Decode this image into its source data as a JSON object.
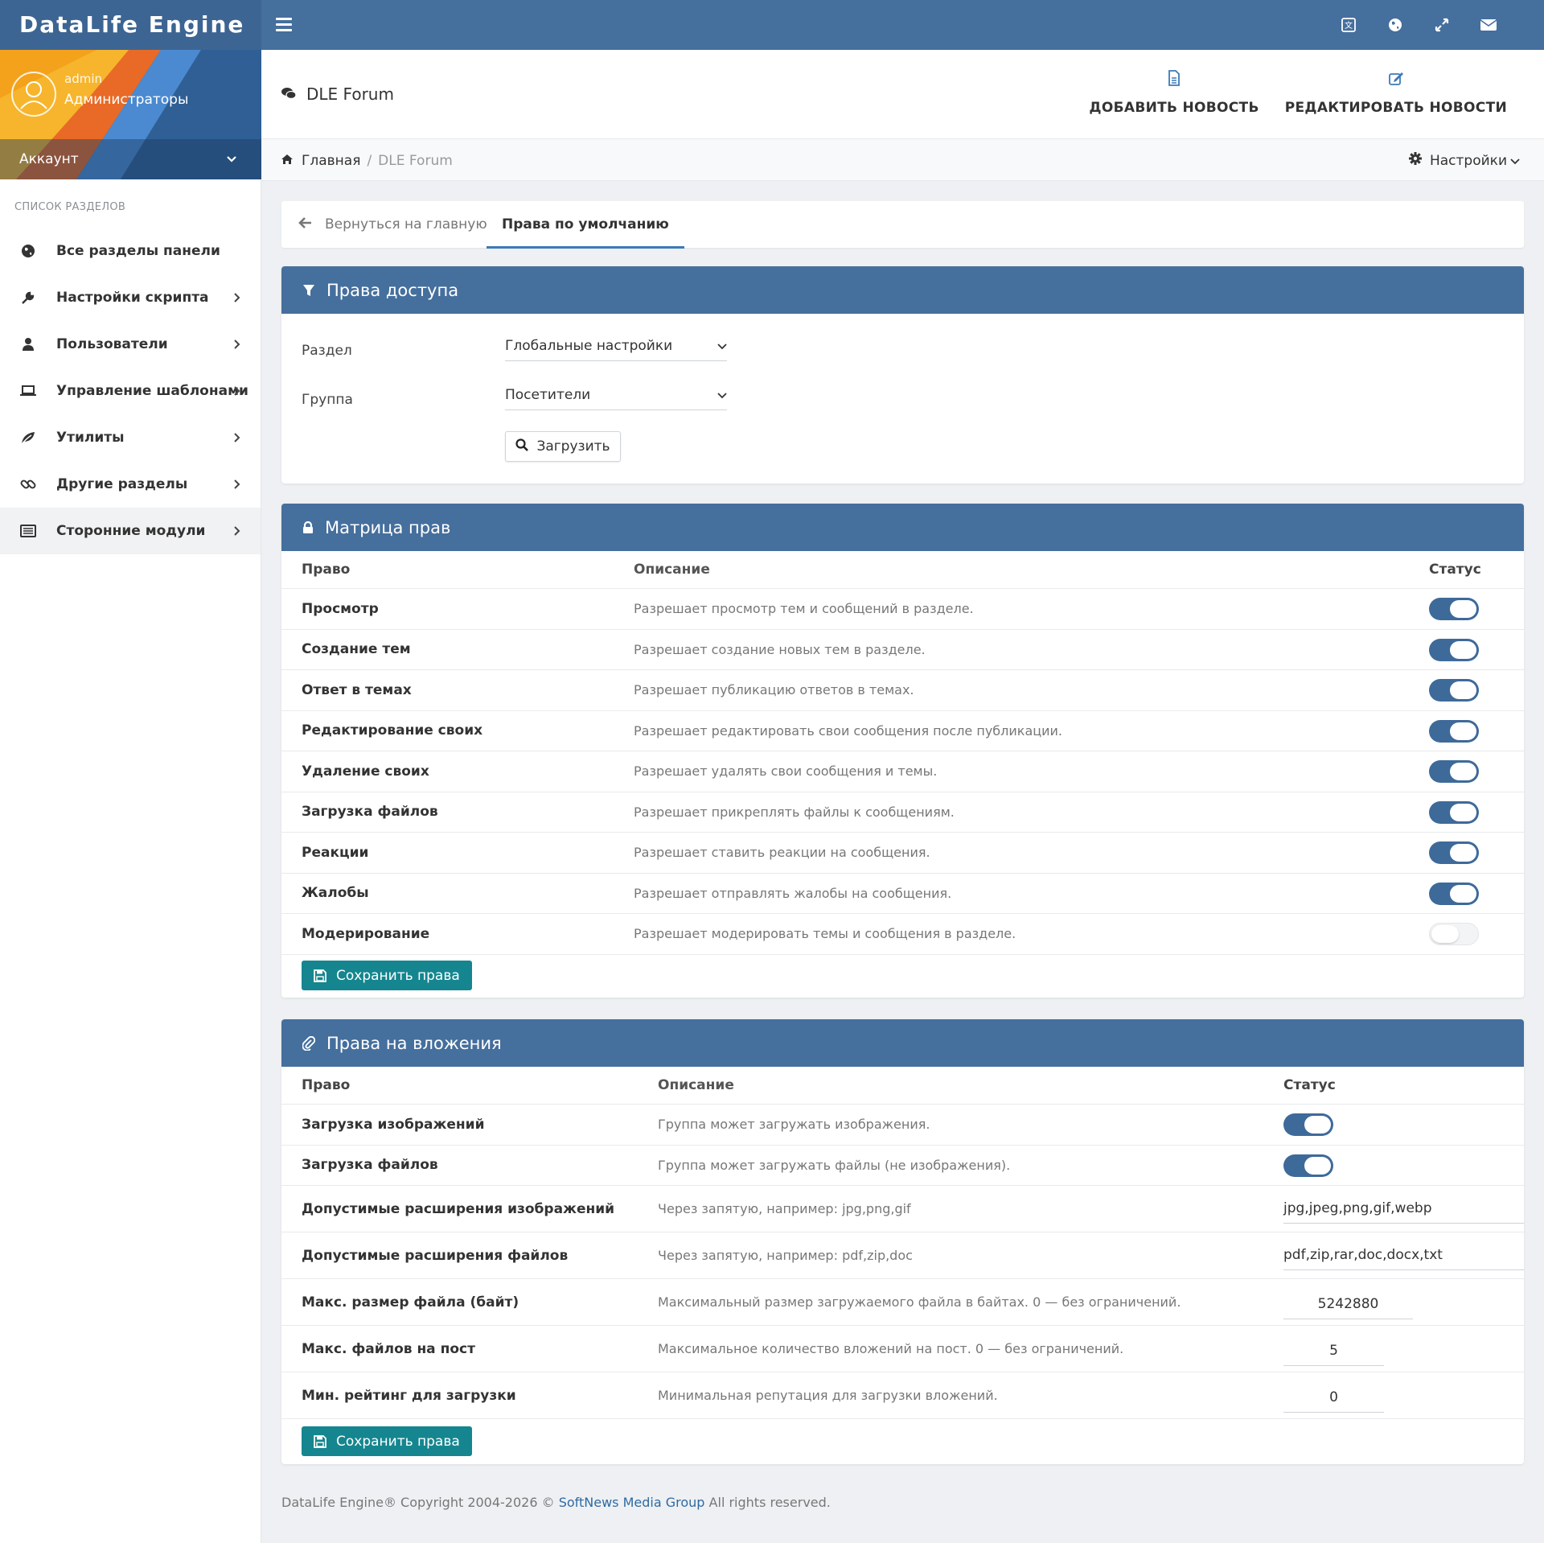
{
  "brand": "DataLife Engine",
  "colors": {
    "header": "#456f9d",
    "accent": "#3e6a9a",
    "save_button": "#15868f",
    "link": "#2f6aa3"
  },
  "topbar": {
    "icons": [
      "hamburger-menu-icon",
      "language-icon",
      "globe-icon",
      "fullscreen-icon",
      "envelope-icon"
    ]
  },
  "user": {
    "login": "admin",
    "group": "Администраторы",
    "account_label": "Аккаунт"
  },
  "sidebar": {
    "title": "СПИСОК РАЗДЕЛОВ",
    "items": [
      {
        "label": "Все разделы панели",
        "icon": "globe-icon"
      },
      {
        "label": "Настройки скрипта",
        "icon": "wrench-icon"
      },
      {
        "label": "Пользователи",
        "icon": "user-icon"
      },
      {
        "label": "Управление шаблонами",
        "icon": "laptop-icon"
      },
      {
        "label": "Утилиты",
        "icon": "leaf-icon"
      },
      {
        "label": "Другие разделы",
        "icon": "link-icon"
      },
      {
        "label": "Сторонние модули",
        "icon": "list-icon"
      }
    ]
  },
  "header": {
    "title": "DLE Forum",
    "add_news": "ДОБАВИТЬ НОВОСТЬ",
    "edit_news": "РЕДАКТИРОВАТЬ НОВОСТИ"
  },
  "breadcrumb": {
    "home": "Главная",
    "sep": "/",
    "current": "DLE Forum"
  },
  "settings_label": "Настройки",
  "tabs": {
    "back": "Вернуться на главную",
    "current": "Права по умолчанию"
  },
  "access": {
    "title": "Права доступа",
    "section_label": "Раздел",
    "section_value": "Глобальные настройки",
    "group_label": "Группа",
    "group_value": "Посетители",
    "load_button": "Загрузить"
  },
  "matrix": {
    "title": "Матрица прав",
    "col_right": "Право",
    "col_desc": "Описание",
    "col_status": "Статус",
    "rows": [
      {
        "name": "Просмотр",
        "desc": "Разрешает просмотр тем и сообщений в разделе.",
        "on": true
      },
      {
        "name": "Создание тем",
        "desc": "Разрешает создание новых тем в разделе.",
        "on": true
      },
      {
        "name": "Ответ в темах",
        "desc": "Разрешает публикацию ответов в темах.",
        "on": true
      },
      {
        "name": "Редактирование своих",
        "desc": "Разрешает редактировать свои сообщения после публикации.",
        "on": true
      },
      {
        "name": "Удаление своих",
        "desc": "Разрешает удалять свои сообщения и темы.",
        "on": true
      },
      {
        "name": "Загрузка файлов",
        "desc": "Разрешает прикреплять файлы к сообщениям.",
        "on": true
      },
      {
        "name": "Реакции",
        "desc": "Разрешает ставить реакции на сообщения.",
        "on": true
      },
      {
        "name": "Жалобы",
        "desc": "Разрешает отправлять жалобы на сообщения.",
        "on": true
      },
      {
        "name": "Модерирование",
        "desc": "Разрешает модерировать темы и сообщения в разделе.",
        "on": false
      }
    ],
    "save_button": "Сохранить права"
  },
  "attach": {
    "title": "Права на вложения",
    "col_right": "Право",
    "col_desc": "Описание",
    "col_status": "Статус",
    "rows": [
      {
        "name": "Загрузка изображений",
        "desc": "Группа может загружать изображения.",
        "type": "toggle",
        "on": true
      },
      {
        "name": "Загрузка файлов",
        "desc": "Группа может загружать файлы (не изображения).",
        "type": "toggle",
        "on": true
      },
      {
        "name": "Допустимые расширения изображений",
        "desc": "Через запятую, например: jpg,png,gif",
        "type": "text",
        "value": "jpg,jpeg,png,gif,webp"
      },
      {
        "name": "Допустимые расширения файлов",
        "desc": "Через запятую, например: pdf,zip,doc",
        "type": "text",
        "value": "pdf,zip,rar,doc,docx,txt"
      },
      {
        "name": "Макс. размер файла (байт)",
        "desc": "Максимальный размер загружаемого файла в байтах. 0 — без ограничений.",
        "type": "number",
        "value": "5242880"
      },
      {
        "name": "Макс. файлов на пост",
        "desc": "Максимальное количество вложений на пост. 0 — без ограничений.",
        "type": "number",
        "value": "5"
      },
      {
        "name": "Мин. рейтинг для загрузки",
        "desc": "Минимальная репутация для загрузки вложений.",
        "type": "number",
        "value": "0"
      }
    ],
    "save_button": "Сохранить права"
  },
  "footer": {
    "prefix": "DataLife Engine® Copyright 2004-2026 ©",
    "link": "SoftNews Media Group",
    "suffix": "All rights reserved."
  }
}
